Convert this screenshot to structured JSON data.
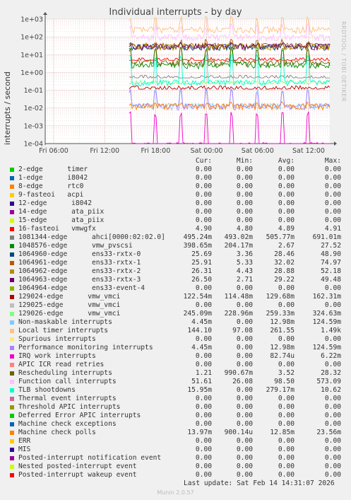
{
  "chart_data": {
    "type": "line",
    "title": "Individual interrupts - by day",
    "ylabel": "interrupts / second",
    "y_scale": "log",
    "ylim": [
      0.0001,
      1000
    ],
    "y_ticks": [
      "1e+03",
      "1e+02",
      "1e+01",
      "1e+00",
      "1e-01",
      "1e-02",
      "1e-03",
      "1e-04"
    ],
    "x_ticks": [
      "Fri 06:00",
      "Fri 12:00",
      "Fri 18:00",
      "Sat 00:00",
      "Sat 06:00",
      "Sat 12:00"
    ],
    "grid": true,
    "brand_text": "RRDTOOL / TOBI OETIKER",
    "columns": [
      "Cur:",
      "Min:",
      "Avg:",
      "Max:"
    ],
    "series": [
      {
        "name": "2-edge      timer",
        "color": "#00cc00",
        "cur": "0.00",
        "min": "0.00",
        "avg": "0.00",
        "max": "0.00"
      },
      {
        "name": "1-edge      i8042",
        "color": "#0066b3",
        "cur": "0.00",
        "min": "0.00",
        "avg": "0.00",
        "max": "0.00"
      },
      {
        "name": "8-edge      rtc0",
        "color": "#ff8000",
        "cur": "0.00",
        "min": "0.00",
        "avg": "0.00",
        "max": "0.00"
      },
      {
        "name": "9-fasteoi   acpi",
        "color": "#ffcc00",
        "cur": "0.00",
        "min": "0.00",
        "avg": "0.00",
        "max": "0.00"
      },
      {
        "name": "12-edge      i8042",
        "color": "#330099",
        "cur": "0.00",
        "min": "0.00",
        "avg": "0.00",
        "max": "0.00"
      },
      {
        "name": "14-edge      ata_piix",
        "color": "#990099",
        "cur": "0.00",
        "min": "0.00",
        "avg": "0.00",
        "max": "0.00"
      },
      {
        "name": "15-edge      ata_piix",
        "color": "#ccff00",
        "cur": "0.00",
        "min": "0.00",
        "avg": "0.00",
        "max": "0.00"
      },
      {
        "name": "16-fasteoi   vmwgfx",
        "color": "#ff0000",
        "cur": "4.90",
        "min": "4.80",
        "avg": "4.89",
        "max": "4.91"
      },
      {
        "name": "1081344-edge      ahci[0000:02:02.0]",
        "color": "#808080",
        "cur": "495.24m",
        "min": "493.02m",
        "avg": "505.77m",
        "max": "691.01m"
      },
      {
        "name": "1048576-edge      vmw_pvscsi",
        "color": "#008f00",
        "cur": "398.65m",
        "min": "204.17m",
        "avg": "2.67",
        "max": "27.52"
      },
      {
        "name": "1064960-edge      ens33-rxtx-0",
        "color": "#00487d",
        "cur": "25.69",
        "min": "3.36",
        "avg": "28.46",
        "max": "48.90"
      },
      {
        "name": "1064961-edge      ens33-rxtx-1",
        "color": "#b35a00",
        "cur": "25.91",
        "min": "5.33",
        "avg": "32.02",
        "max": "74.97"
      },
      {
        "name": "1064962-edge      ens33-rxtx-2",
        "color": "#b38f00",
        "cur": "26.31",
        "min": "4.43",
        "avg": "28.88",
        "max": "52.18"
      },
      {
        "name": "1064963-edge      ens33-rxtx-3",
        "color": "#6b006b",
        "cur": "26.50",
        "min": "2.71",
        "avg": "29.22",
        "max": "49.48"
      },
      {
        "name": "1064964-edge      ens33-event-4",
        "color": "#8fb300",
        "cur": "0.00",
        "min": "0.00",
        "avg": "0.00",
        "max": "0.00"
      },
      {
        "name": "129024-edge      vmw_vmci",
        "color": "#b30000",
        "cur": "122.54m",
        "min": "114.48m",
        "avg": "129.68m",
        "max": "162.31m"
      },
      {
        "name": "129025-edge      vmw_vmci",
        "color": "#bebebe",
        "cur": "0.00",
        "min": "0.00",
        "avg": "0.00",
        "max": "0.00"
      },
      {
        "name": "129026-edge      vmw_vmci",
        "color": "#80ff80",
        "cur": "245.09m",
        "min": "228.96m",
        "avg": "259.33m",
        "max": "324.63m"
      },
      {
        "name": "Non-maskable interrupts",
        "color": "#80c9ff",
        "cur": "4.45m",
        "min": "0.00",
        "avg": "12.98m",
        "max": "124.59m"
      },
      {
        "name": "Local timer interrupts",
        "color": "#ffc080",
        "cur": "144.10",
        "min": "97.08",
        "avg": "261.55",
        "max": "1.49k"
      },
      {
        "name": "Spurious interrupts",
        "color": "#ffe680",
        "cur": "0.00",
        "min": "0.00",
        "avg": "0.00",
        "max": "0.00"
      },
      {
        "name": "Performance monitoring interrupts",
        "color": "#aa80ff",
        "cur": "4.45m",
        "min": "0.00",
        "avg": "12.98m",
        "max": "124.59m"
      },
      {
        "name": "IRQ work interrupts",
        "color": "#ee00cc",
        "cur": "0.00",
        "min": "0.00",
        "avg": "82.74u",
        "max": "6.22m"
      },
      {
        "name": "APIC ICR read retries",
        "color": "#ff8080",
        "cur": "0.00",
        "min": "0.00",
        "avg": "0.00",
        "max": "0.00"
      },
      {
        "name": "Rescheduling interrupts",
        "color": "#666600",
        "cur": "1.21",
        "min": "990.67m",
        "avg": "3.52",
        "max": "28.32"
      },
      {
        "name": "Function call interrupts",
        "color": "#ffbfff",
        "cur": "51.61",
        "min": "26.08",
        "avg": "98.50",
        "max": "573.09"
      },
      {
        "name": "TLB shootdowns",
        "color": "#00ffcc",
        "cur": "15.95m",
        "min": "0.00",
        "avg": "279.17m",
        "max": "10.62"
      },
      {
        "name": "Thermal event interrupts",
        "color": "#cc6699",
        "cur": "0.00",
        "min": "0.00",
        "avg": "0.00",
        "max": "0.00"
      },
      {
        "name": "Threshold APIC interrupts",
        "color": "#999900",
        "cur": "0.00",
        "min": "0.00",
        "avg": "0.00",
        "max": "0.00"
      },
      {
        "name": "Deferred Error APIC interrupts",
        "color": "#00cc00",
        "cur": "0.00",
        "min": "0.00",
        "avg": "0.00",
        "max": "0.00"
      },
      {
        "name": "Machine check exceptions",
        "color": "#0066b3",
        "cur": "0.00",
        "min": "0.00",
        "avg": "0.00",
        "max": "0.00"
      },
      {
        "name": "Machine check polls",
        "color": "#ff8000",
        "cur": "13.97m",
        "min": "900.14u",
        "avg": "12.85m",
        "max": "23.56m"
      },
      {
        "name": "ERR",
        "color": "#ffcc00",
        "cur": "0.00",
        "min": "0.00",
        "avg": "0.00",
        "max": "0.00"
      },
      {
        "name": "MIS",
        "color": "#330099",
        "cur": "0.00",
        "min": "0.00",
        "avg": "0.00",
        "max": "0.00"
      },
      {
        "name": "Posted-interrupt notification event",
        "color": "#990099",
        "cur": "0.00",
        "min": "0.00",
        "avg": "0.00",
        "max": "0.00"
      },
      {
        "name": "Nested posted-interrupt event",
        "color": "#ccff00",
        "cur": "0.00",
        "min": "0.00",
        "avg": "0.00",
        "max": "0.00"
      },
      {
        "name": "Posted-interrupt wakeup event",
        "color": "#ff0000",
        "cur": "0.00",
        "min": "0.00",
        "avg": "0.00",
        "max": "0.00"
      }
    ],
    "last_update": "Last update: Sat Feb 14 14:31:07 2026",
    "footer": "Munin 2.0.57"
  }
}
